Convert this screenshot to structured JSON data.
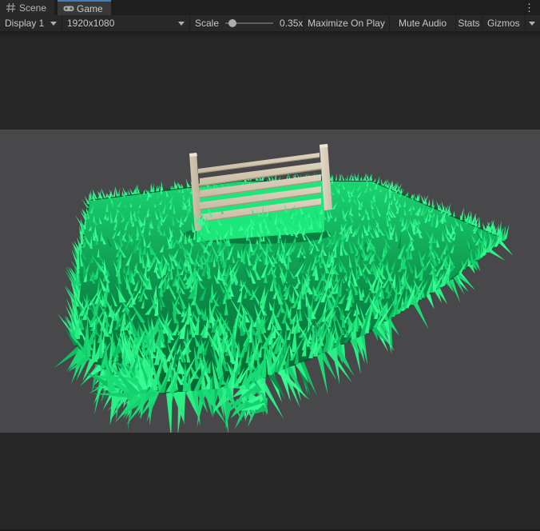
{
  "tabs": [
    {
      "label": "Scene",
      "icon": "scene-grid-icon",
      "active": false
    },
    {
      "label": "Game",
      "icon": "gamepad-icon",
      "active": true
    }
  ],
  "tab_overflow_icon": "kebab-menu",
  "toolbar": {
    "display": "Display 1",
    "resolution": "1920x1080",
    "scale_label": "Scale",
    "scale_value": "0.35x",
    "scale_fraction": 0.15,
    "buttons": [
      "Maximize On Play",
      "Mute Audio",
      "Stats",
      "Gizmos"
    ]
  },
  "scene": {
    "objects": [
      "grass-field",
      "wooden-fence"
    ],
    "colors": {
      "accent_tab": "#3d7ebb",
      "viewport_bg": "#48474a",
      "letterbox_bg": "#272727",
      "grass_bright": "#36fa93",
      "grass_bright2": "#2bef85",
      "grass_mid": "#19dc75",
      "grass_mid2": "#15d06e",
      "grass_dark": "#0fbf62",
      "grass_deep": "#0a8f4c",
      "grass_base_far": "#1bd572",
      "grass_base_mid": "#0b8a47",
      "grass_base_near": "#056230",
      "grass_backlit": "#1ce77b",
      "fence_rail_light": "#ddd3c0",
      "fence_rail_dark": "#c6baa1",
      "fence_post_left_light": "#d3c8b3",
      "fence_post_left_dark": "#bcaf96",
      "fence_post_right_light": "#e4dbcb",
      "fence_post_right_dark": "#ccc0a9",
      "fence_cap": "#ece5d6",
      "fence_shadow_line": "#a3977d"
    }
  }
}
